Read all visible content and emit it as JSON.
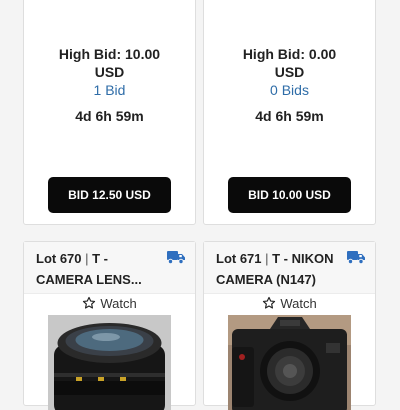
{
  "cards": [
    {
      "high_bid": "High Bid: 10.00",
      "currency": "USD",
      "bids": "1 Bid",
      "time_left": "4d 6h 59m",
      "bid_button": "BID 12.50 USD"
    },
    {
      "high_bid": "High Bid: 0.00",
      "currency": "USD",
      "bids": "0 Bids",
      "time_left": "4d 6h 59m",
      "bid_button": "BID 10.00 USD"
    }
  ],
  "lots": [
    {
      "lot_number": "Lot 670",
      "separator": " | ",
      "title": "T - CAMERA LENS...",
      "watch_label": "Watch",
      "shipping_icon": "truck-icon",
      "watch_icon": "star-outline-icon",
      "photo": "camera-lens-photo"
    },
    {
      "lot_number": "Lot 671",
      "separator": " | ",
      "title": "T - NIKON CAMERA (N147)",
      "watch_label": "Watch",
      "shipping_icon": "truck-icon",
      "watch_icon": "star-outline-icon",
      "photo": "nikon-camera-photo"
    }
  ],
  "colors": {
    "button_bg": "#0a0a0a",
    "link_blue": "#2f6da8",
    "truck_blue": "#2f6fbf"
  }
}
